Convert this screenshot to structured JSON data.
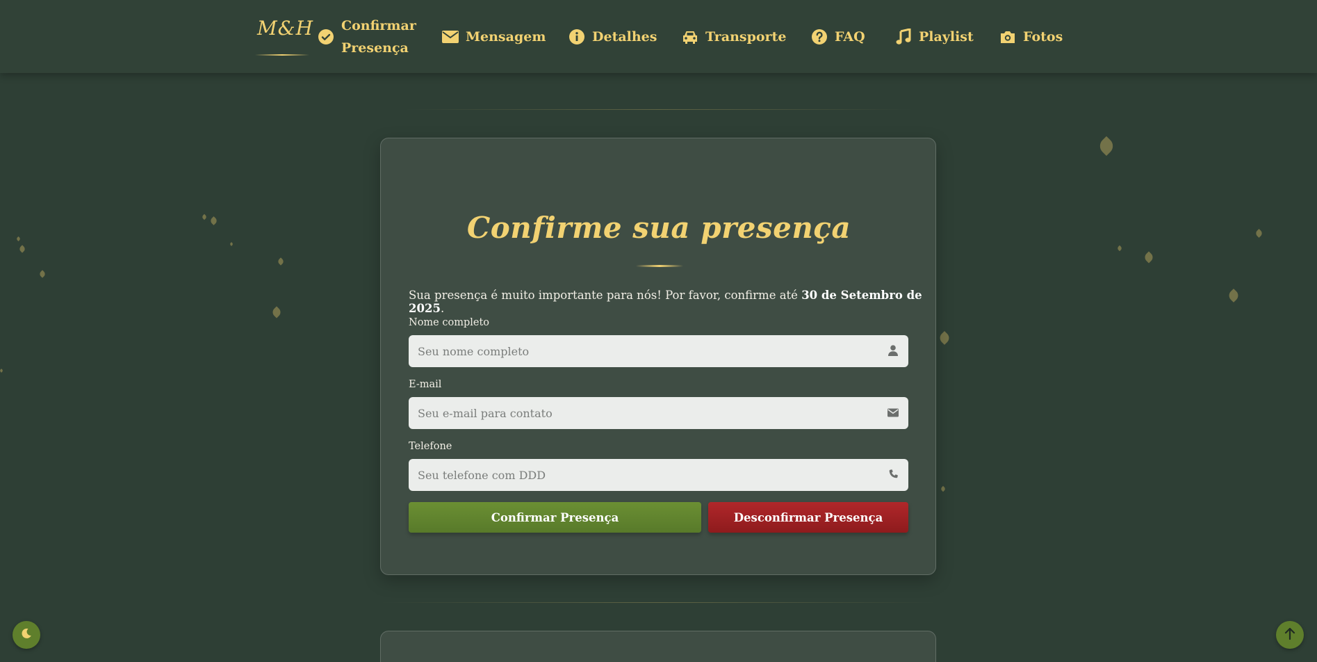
{
  "nav": {
    "logo": "M&H",
    "items": [
      {
        "label": "Confirmar Presença",
        "icon": "check-circle-icon"
      },
      {
        "label": "Mensagem",
        "icon": "envelope-icon"
      },
      {
        "label": "Detalhes",
        "icon": "info-circle-icon"
      },
      {
        "label": "Transporte",
        "icon": "car-icon"
      },
      {
        "label": "FAQ",
        "icon": "question-circle-icon"
      },
      {
        "label": "Playlist",
        "icon": "music-icon"
      },
      {
        "label": "Fotos",
        "icon": "camera-icon"
      }
    ]
  },
  "rsvp": {
    "title": "Confirme sua presença",
    "intro_prefix": "Sua presença é muito importante para nós! Por favor, confirme até ",
    "deadline": "30 de Setembro de 2025",
    "intro_suffix": ".",
    "fields": [
      {
        "label": "Nome completo",
        "placeholder": "Seu nome completo",
        "value": "",
        "icon": "user-icon"
      },
      {
        "label": "E-mail",
        "placeholder": "Seu e-mail para contato",
        "value": "",
        "icon": "envelope-icon"
      },
      {
        "label": "Telefone",
        "placeholder": "Seu telefone com DDD",
        "value": "",
        "icon": "phone-icon"
      }
    ],
    "confirm_label": "Confirmar Presença",
    "unconfirm_label": "Desconfirmar Presença"
  },
  "colors": {
    "background": "#2e3f35",
    "navbar": "#314237",
    "card": "#3f4d44",
    "accent_gold": "#f2d272",
    "confirm_green": "#6b8f33",
    "unconfirm_red": "#a82326",
    "fab_green": "#5f7f2c"
  },
  "controls": {
    "theme_toggle_icon": "moon-icon",
    "scroll_top_icon": "arrow-up-icon"
  }
}
